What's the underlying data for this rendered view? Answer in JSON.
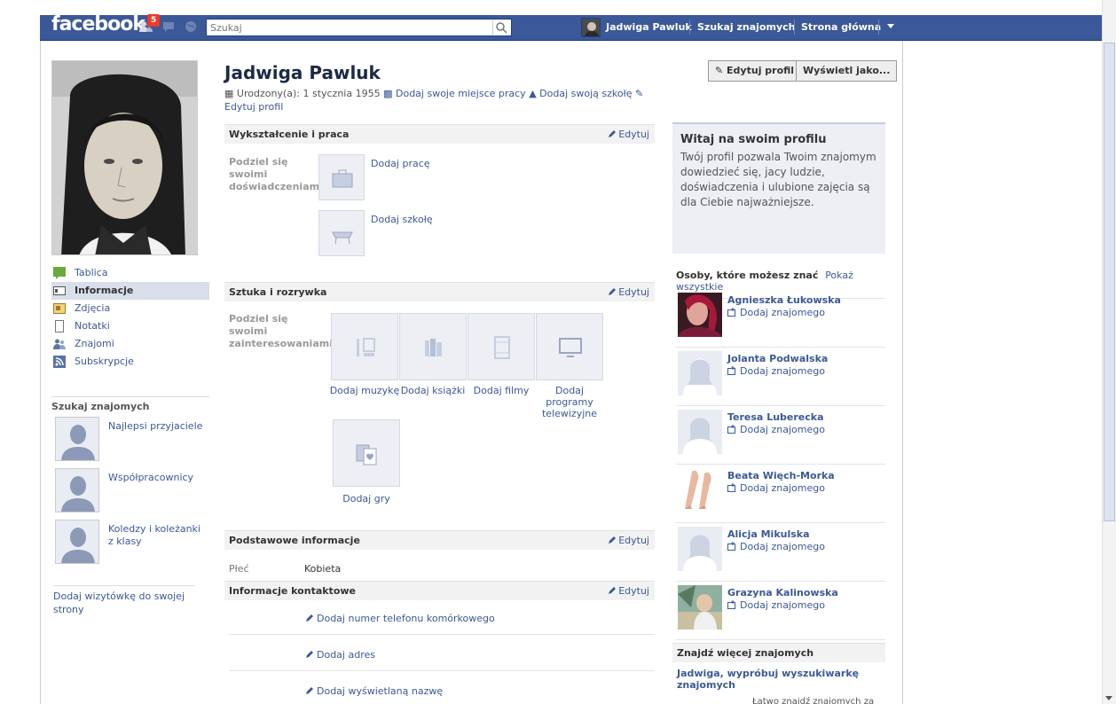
{
  "topbar": {
    "logo": "facebook",
    "notif_count": "5",
    "search_placeholder": "Szukaj",
    "user_name": "Jadwiga Pawluk",
    "find_friends": "Szukaj znajomych",
    "home": "Strona główna"
  },
  "profile": {
    "name": "Jadwiga Pawluk",
    "meta": {
      "birth": "Urodzony(a): 1 stycznia 1955",
      "add_work": "Dodaj swoje miejsce pracy",
      "add_school": "Dodaj swoją szkołę",
      "edit_profile": "Edytuj profil"
    },
    "btn_edit": "Edytuj profil",
    "btn_view_as": "Wyświetl jako..."
  },
  "left_nav": {
    "items": [
      "Tablica",
      "Informacje",
      "Zdjęcia",
      "Notatki",
      "Znajomi",
      "Subskrypcje"
    ],
    "find_heading": "Szukaj znajomych",
    "groups": [
      "Najlepsi przyjaciele",
      "Współpracownicy",
      "Koledzy i koleżanki z klasy"
    ],
    "add_card": "Dodaj wizytówkę do swojej strony"
  },
  "sections": {
    "edu": {
      "title": "Wykształcenie i praca",
      "edit": "Edytuj",
      "prompt": "Podziel się swoimi doświadczeniami",
      "add_work": "Dodaj pracę",
      "add_school": "Dodaj szkołę"
    },
    "arts": {
      "title": "Sztuka i rozrywka",
      "edit": "Edytuj",
      "prompt": "Podziel się swoimi zainteresowaniami",
      "tiles": [
        "Dodaj muzykę",
        "Dodaj książki",
        "Dodaj filmy",
        "Dodaj programy telewizyjne",
        "Dodaj gry"
      ]
    },
    "basic": {
      "title": "Podstawowe informacje",
      "edit": "Edytuj",
      "gender_label": "Płeć",
      "gender_value": "Kobieta"
    },
    "contact": {
      "title": "Informacje kontaktowe",
      "edit": "Edytuj",
      "rows": [
        "Dodaj numer telefonu komórkowego",
        "Dodaj adres",
        "Dodaj wyświetlaną nazwę"
      ]
    }
  },
  "welcome": {
    "title": "Witaj na swoim profilu",
    "text": "Twój profil pozwala Twoim znajomym dowiedzieć się, jacy ludzie, doświadczenia i ulubione zajęcia są dla Ciebie najważniejsze."
  },
  "pymk": {
    "title": "Osoby, które możesz znać",
    "show_all": "Pokaż wszystkie",
    "add_label": "Dodaj znajomego",
    "people": [
      "Agnieszka Łukowska",
      "Jolanta Podwalska",
      "Teresa Luberecka",
      "Beata Więch-Morka",
      "Alicja Mikulska",
      "Grazyna Kalinowska"
    ]
  },
  "find_more": {
    "title": "Znajdź więcej znajomych",
    "link": "Jadwiga, wypróbuj wyszukiwarkę znajomych",
    "text": "Łatwo znajdź znajomych za"
  }
}
